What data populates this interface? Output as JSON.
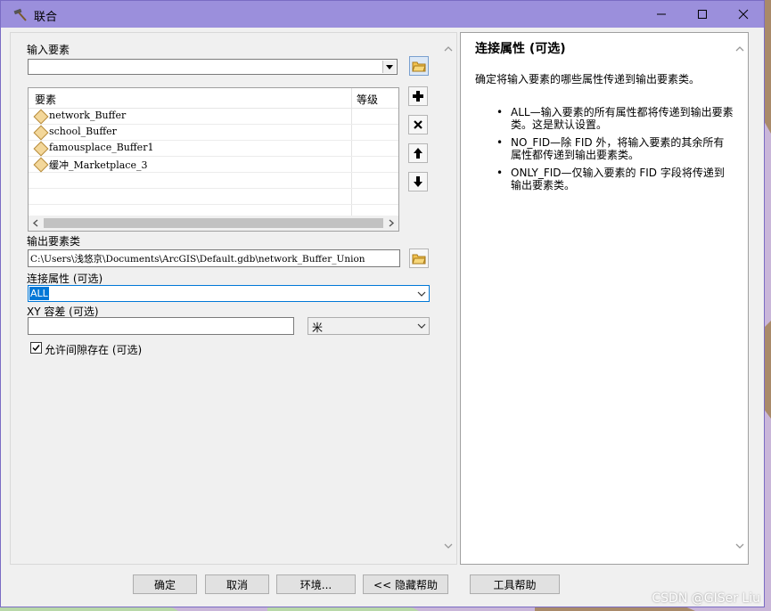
{
  "window": {
    "title": "联合"
  },
  "form": {
    "input_features_label": "输入要素",
    "input_features_value": "",
    "list_header_name": "要素",
    "list_header_rank": "等级",
    "features": [
      "network_Buffer",
      "school_Buffer",
      "famousplace_Buffer1",
      "缓冲_Marketplace_3"
    ],
    "output_label": "输出要素类",
    "output_value": "C:\\Users\\浅悠京\\Documents\\ArcGIS\\Default.gdb\\network_Buffer_Union",
    "join_attr_label": "连接属性 (可选)",
    "join_attr_value": "ALL",
    "xy_tol_label": "XY 容差 (可选)",
    "xy_tol_value": "",
    "xy_unit": "米",
    "gaps_label": "允许间隙存在 (可选)",
    "gaps_checked": true
  },
  "buttons": {
    "ok": "确定",
    "cancel": "取消",
    "env": "环境...",
    "hide_help": "<< 隐藏帮助",
    "tool_help": "工具帮助"
  },
  "help": {
    "title": "连接属性 (可选)",
    "desc": "确定将输入要素的哪些属性传递到输出要素类。",
    "items": [
      "ALL—输入要素的所有属性都将传递到输出要素类。这是默认设置。",
      "NO_FID—除 FID 外，将输入要素的其余所有属性都传递到输出要素类。",
      "ONLY_FID—仅输入要素的 FID 字段将传递到输出要素类。"
    ]
  },
  "watermark": "CSDN @GISer Liu",
  "colors": {
    "titlebar": "#9b8fdc",
    "selection": "#0078d7"
  }
}
